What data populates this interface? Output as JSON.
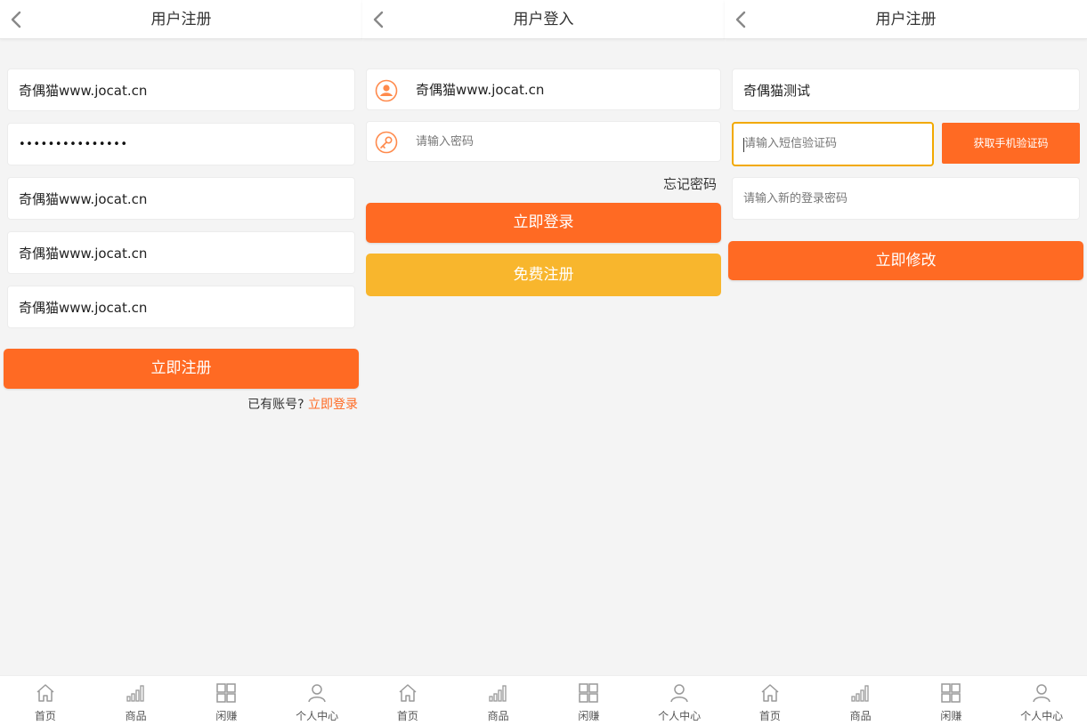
{
  "colors": {
    "accent": "#ff6a23",
    "secondary": "#f8b62d",
    "background": "#f4f4f4",
    "focus": "#f2a900"
  },
  "register": {
    "title": "用户注册",
    "fields": [
      "奇偶猫www.jocat.cn",
      "•••••••••••••••",
      "奇偶猫www.jocat.cn",
      "奇偶猫www.jocat.cn",
      "奇偶猫www.jocat.cn"
    ],
    "submit_label": "立即注册",
    "have_account_text": "已有账号?",
    "login_link": "立即登录"
  },
  "login": {
    "title": "用户登入",
    "username_value": "奇偶猫www.jocat.cn",
    "password_placeholder": "请输入密码",
    "forgot_label": "忘记密码",
    "login_label": "立即登录",
    "register_label": "免费注册"
  },
  "reset": {
    "title": "用户注册",
    "name_value": "奇偶猫测试",
    "sms_placeholder": "请输入短信验证码",
    "get_code_label": "获取手机验证码",
    "new_password_placeholder": "请输入新的登录密码",
    "submit_label": "立即修改"
  },
  "tabbar": [
    {
      "label": "首页",
      "icon": "home-icon"
    },
    {
      "label": "商品",
      "icon": "bar-chart-icon"
    },
    {
      "label": "闲赚",
      "icon": "grid-icon"
    },
    {
      "label": "个人中心",
      "icon": "user-icon"
    }
  ]
}
